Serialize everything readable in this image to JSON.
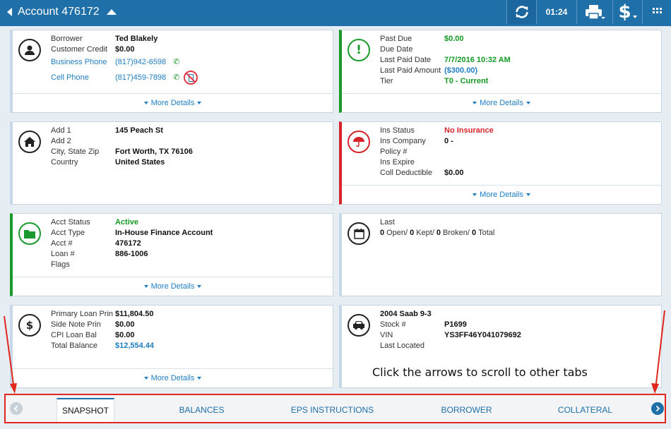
{
  "header": {
    "title": "Account 476172",
    "timer": "01:24"
  },
  "borrower": {
    "rows": [
      {
        "label": "Borrower",
        "value": "Ted Blakely"
      },
      {
        "label": "Customer Credit",
        "value": "$0.00"
      },
      {
        "label": "Business Phone",
        "value": "(817)942-6598"
      },
      {
        "label": "Cell Phone",
        "value": "(817)459-7898"
      }
    ],
    "more": "More Details"
  },
  "status": {
    "rows": [
      {
        "label": "Past Due",
        "value": "$0.00"
      },
      {
        "label": "Due Date",
        "value": ""
      },
      {
        "label": "Last Paid Date",
        "value": "7/7/2016 10:32 AM"
      },
      {
        "label": "Last Paid Amount",
        "value": "($300.00)"
      },
      {
        "label": "Tier",
        "value": "T0 - Current"
      }
    ],
    "more": "More Details"
  },
  "address": {
    "rows": [
      {
        "label": "Add 1",
        "value": "145 Peach St"
      },
      {
        "label": "Add 2",
        "value": ""
      },
      {
        "label": "City, State Zip",
        "value": "Fort Worth, TX 76106"
      },
      {
        "label": "Country",
        "value": "United States"
      }
    ]
  },
  "insurance": {
    "rows": [
      {
        "label": "Ins Status",
        "value": "No Insurance"
      },
      {
        "label": "Ins Company",
        "value": "0 -"
      },
      {
        "label": "Policy #",
        "value": ""
      },
      {
        "label": "Ins Expire",
        "value": ""
      },
      {
        "label": "Coll Deductible",
        "value": "$0.00"
      }
    ],
    "more": "More Details"
  },
  "account": {
    "rows": [
      {
        "label": "Acct Status",
        "value": "Active"
      },
      {
        "label": "Acct Type",
        "value": "In-House Finance Account"
      },
      {
        "label": "Acct #",
        "value": "476172"
      },
      {
        "label": "Loan #",
        "value": "886-1006"
      },
      {
        "label": "Flags",
        "value": ""
      }
    ],
    "more": "More Details"
  },
  "promises": {
    "label": "Last",
    "open": "0",
    "open_label": "Open/",
    "kept": "0",
    "kept_label": "Kept/",
    "broken": "0",
    "broken_label": "Broken/",
    "total": "0",
    "total_label": "Total"
  },
  "balances": {
    "rows": [
      {
        "label": "Primary Loan Prin",
        "value": "$11,804.50"
      },
      {
        "label": "Side Note Prin",
        "value": "$0.00"
      },
      {
        "label": "CPI Loan Bal",
        "value": "$0.00"
      },
      {
        "label": "Total Balance",
        "value": "$12,554.44"
      }
    ],
    "more": "More Details"
  },
  "vehicle": {
    "title": "2004 Saab 9-3",
    "rows": [
      {
        "label": "Stock #",
        "value": "P1699"
      },
      {
        "label": "VIN",
        "value": "YS3FF46Y041079692"
      },
      {
        "label": "Last Located",
        "value": ""
      }
    ]
  },
  "annotation": "Click the arrows to scroll to other tabs",
  "tabs": [
    "SNAPSHOT",
    "BALANCES",
    "EPS INSTRUCTIONS",
    "BORROWER",
    "COLLATERAL"
  ],
  "colors": {
    "brand": "#1f6fa8",
    "ok": "#1a9a2c",
    "alert": "#d8232a",
    "link": "#1f7ec2"
  }
}
